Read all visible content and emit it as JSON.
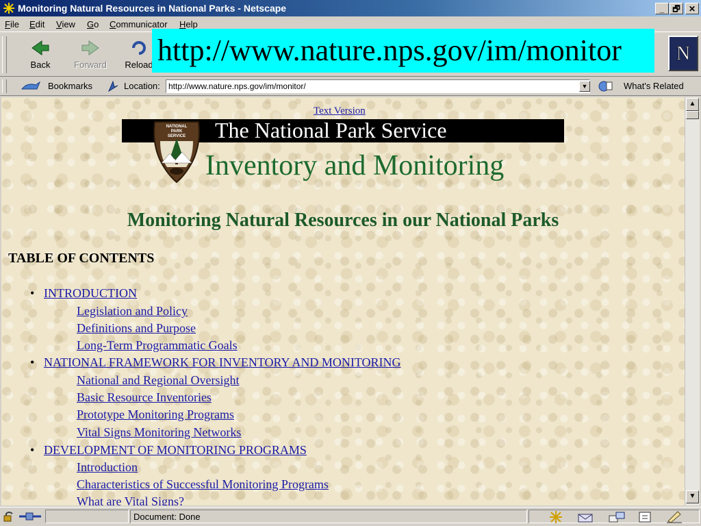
{
  "window": {
    "title": "Monitoring Natural Resources in National Parks - Netscape",
    "controls": [
      "_",
      "🗗",
      "✕"
    ]
  },
  "menu": {
    "items": [
      "File",
      "Edit",
      "View",
      "Go",
      "Communicator",
      "Help"
    ]
  },
  "toolbar": {
    "back_label": "Back",
    "forward_label": "Forward",
    "reload_label": "Reload"
  },
  "url_banner": {
    "text": "http://www.nature.nps.gov/im/monitor",
    "color": "#00ffff"
  },
  "locationbar": {
    "bookmarks_label": "Bookmarks",
    "location_label": "Location:",
    "url": "http://www.nature.nps.gov/im/monitor/",
    "whats_related_label": "What's Related"
  },
  "page": {
    "text_version_link": "Text Version",
    "header_title": "The National Park Service",
    "header_subtitle": "Inventory and Monitoring",
    "logo_text": [
      "NATIONAL",
      "PARK",
      "SERVICE"
    ],
    "heading": "Monitoring Natural Resources in our National Parks",
    "toc_heading": "TABLE OF CONTENTS",
    "toc": [
      {
        "title": "INTRODUCTION",
        "subitems": [
          "Legislation and Policy",
          "Definitions and Purpose",
          "Long-Term Programmatic Goals"
        ]
      },
      {
        "title": "NATIONAL FRAMEWORK FOR INVENTORY AND MONITORING",
        "subitems": [
          "National and Regional Oversight",
          "Basic Resource Inventories",
          "Prototype Monitoring Programs",
          "Vital Signs Monitoring Networks"
        ]
      },
      {
        "title": "DEVELOPMENT OF MONITORING PROGRAMS",
        "subitems": [
          "Introduction",
          "Characteristics of Successful Monitoring Programs",
          "What are Vital Signs?"
        ]
      }
    ],
    "link_color": "#1a1aa6",
    "heading_color": "#1d5a2a"
  },
  "status": {
    "text": "Document: Done"
  }
}
